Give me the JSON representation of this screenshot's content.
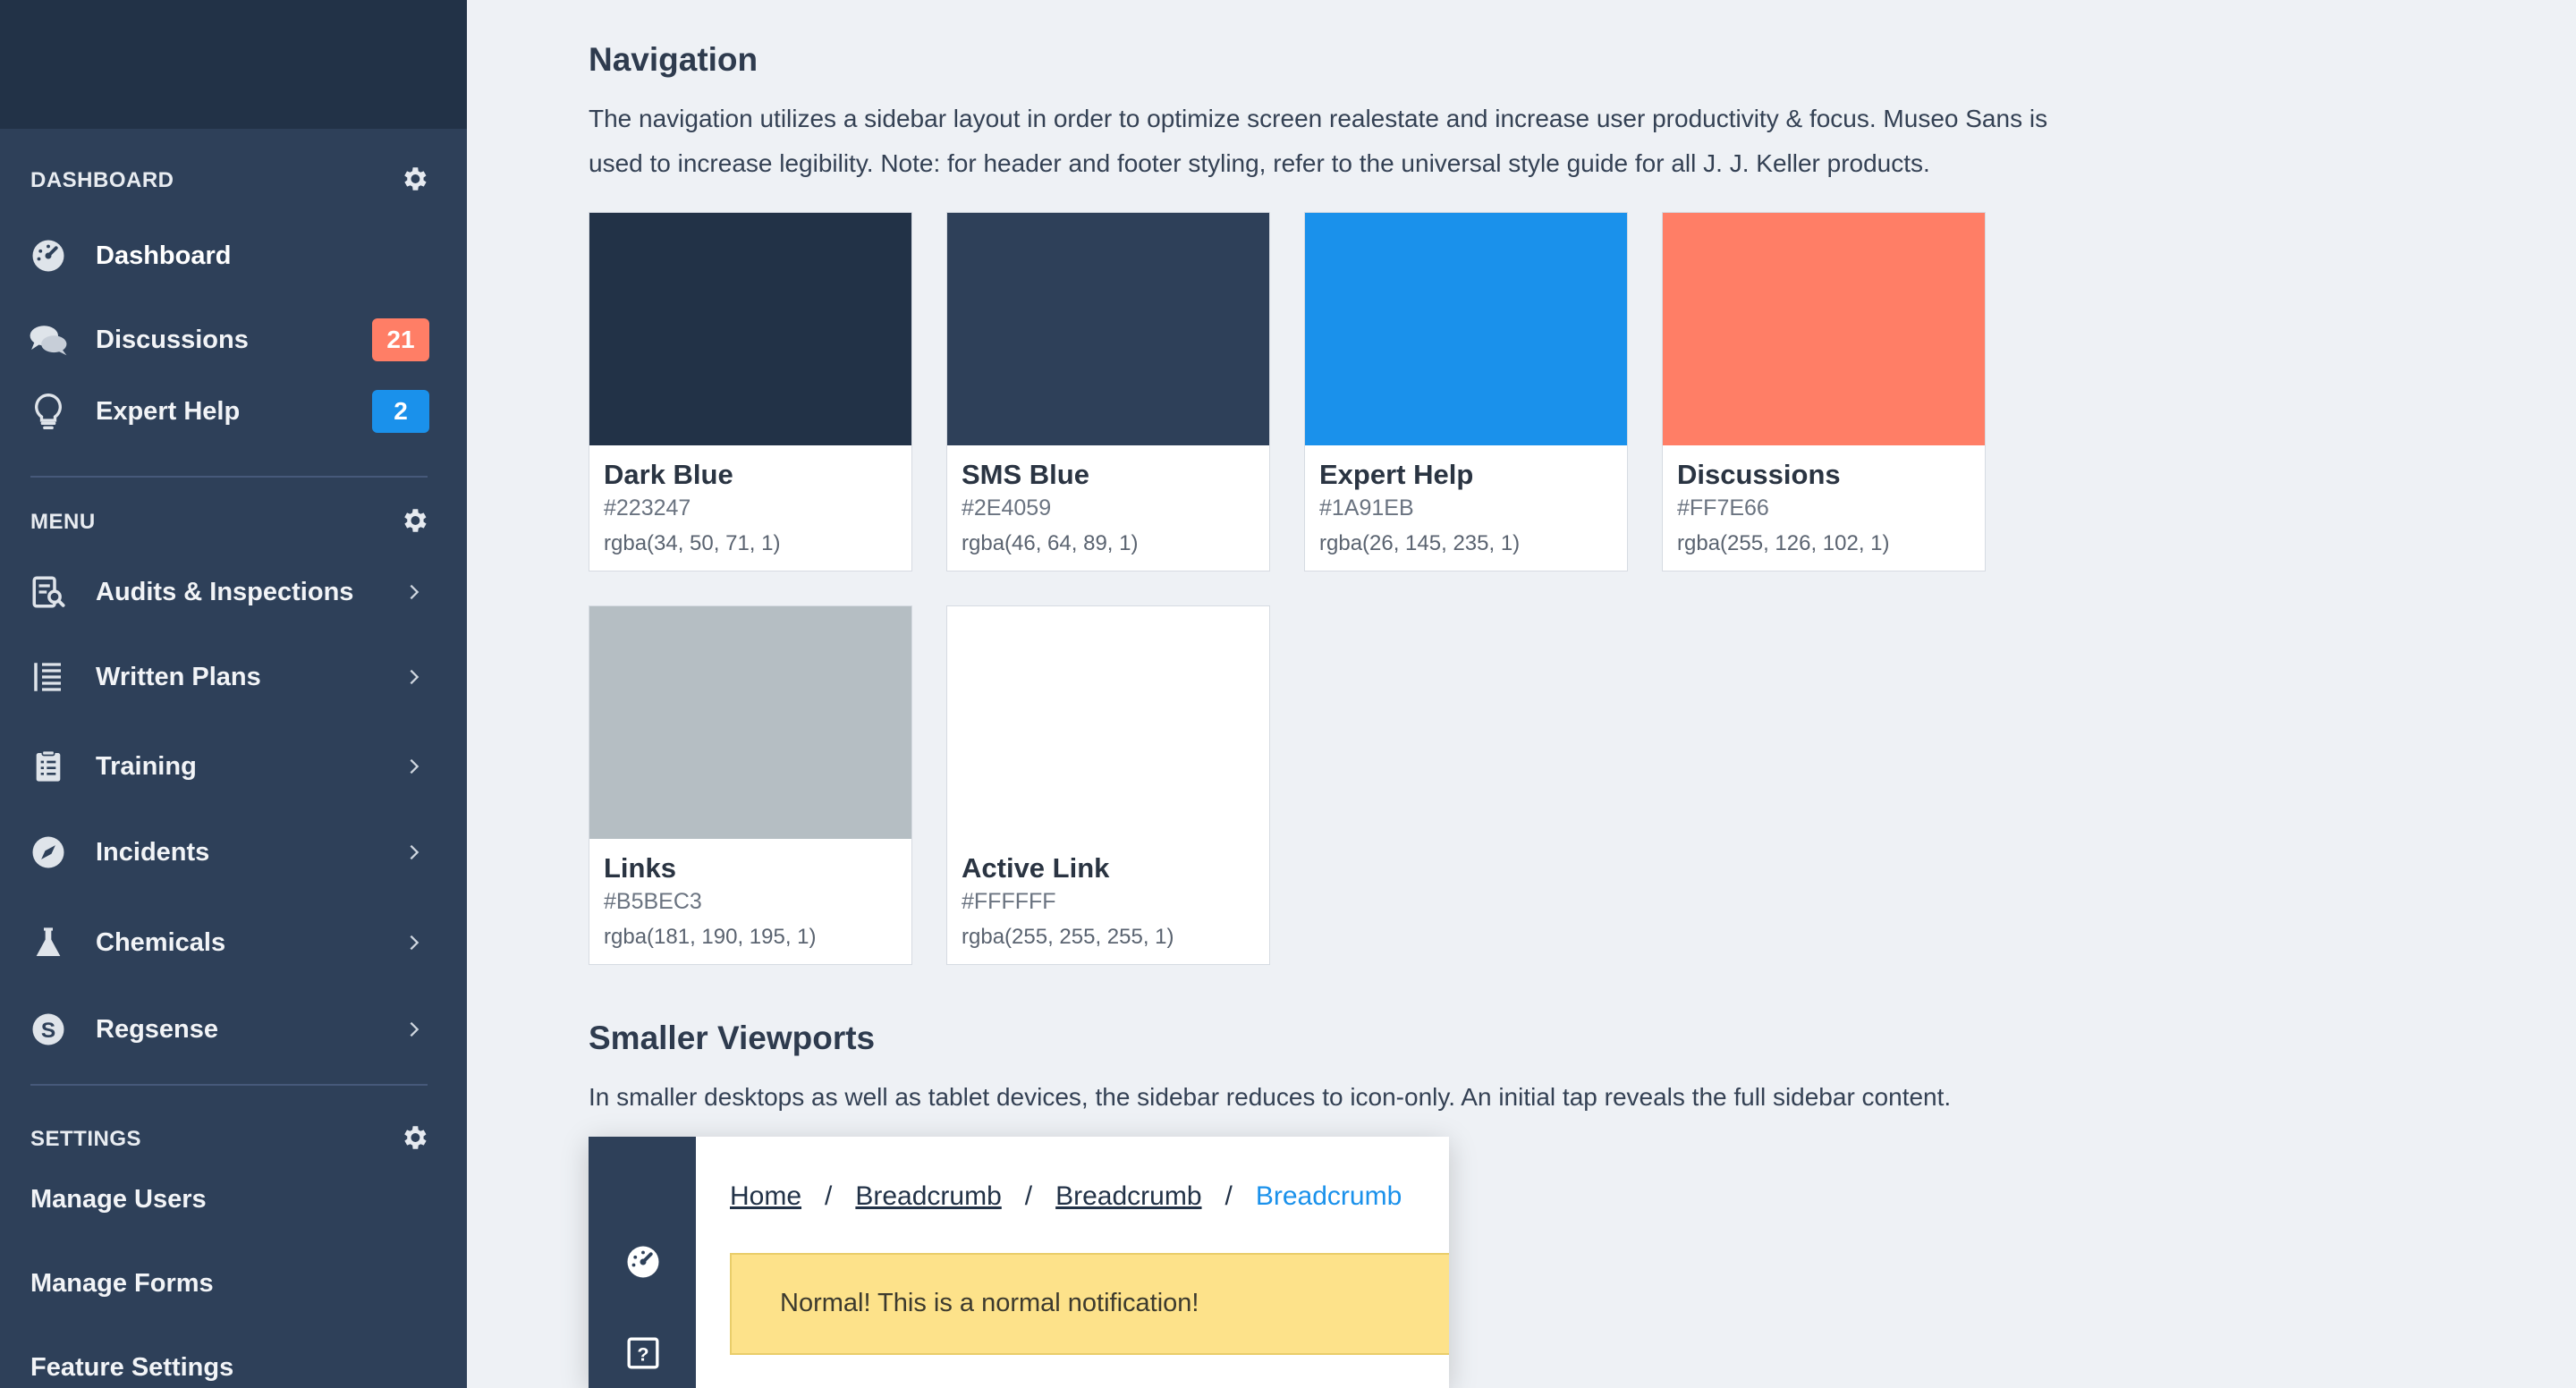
{
  "sidebar": {
    "sections": {
      "dashboard": "DASHBOARD",
      "menu": "MENU",
      "settings": "SETTINGS"
    },
    "primary": [
      {
        "label": "Dashboard",
        "icon": "dashboard-gauge-icon"
      },
      {
        "label": "Discussions",
        "icon": "chat-bubbles-icon",
        "badge": "21",
        "badge_color": "#FF7E66"
      },
      {
        "label": "Expert Help",
        "icon": "lightbulb-icon",
        "badge": "2",
        "badge_color": "#1A91EB"
      }
    ],
    "menu": [
      {
        "label": "Audits & Inspections",
        "icon": "clipboard-search-icon"
      },
      {
        "label": "Written Plans",
        "icon": "notebook-icon"
      },
      {
        "label": "Training",
        "icon": "checklist-icon"
      },
      {
        "label": "Incidents",
        "icon": "compass-icon"
      },
      {
        "label": "Chemicals",
        "icon": "flask-icon"
      },
      {
        "label": "Regsense",
        "icon": "regsense-logo-icon"
      }
    ],
    "settings": [
      {
        "label": "Manage Users"
      },
      {
        "label": "Manage Forms"
      },
      {
        "label": "Feature Settings"
      }
    ]
  },
  "navigation": {
    "title": "Navigation",
    "description": "The navigation utilizes a sidebar layout in order to optimize screen realestate and increase user productivity & focus. Museo Sans is used to increase legibility. Note: for header and footer styling, refer to the universal style guide for all J. J. Keller products."
  },
  "swatches": [
    {
      "name": "Dark Blue",
      "hex": "#223247",
      "rgba": "rgba(34, 50, 71, 1)"
    },
    {
      "name": "SMS Blue",
      "hex": "#2E4059",
      "rgba": "rgba(46, 64, 89, 1)"
    },
    {
      "name": "Expert Help",
      "hex": "#1A91EB",
      "rgba": "rgba(26, 145, 235, 1)"
    },
    {
      "name": "Discussions",
      "hex": "#FF7E66",
      "rgba": "rgba(255, 126, 102, 1)"
    },
    {
      "name": "Links",
      "hex": "#B5BEC3",
      "rgba": "rgba(181, 190, 195, 1)"
    },
    {
      "name": "Active Link",
      "hex": "#FFFFFF",
      "rgba": "rgba(255, 255, 255, 1)"
    }
  ],
  "smaller": {
    "title": "Smaller Viewports",
    "description": "In smaller desktops as well as tablet devices, the sidebar reduces to icon-only. An initial tap reveals the full sidebar content."
  },
  "example": {
    "breadcrumbs": [
      "Home",
      "Breadcrumb",
      "Breadcrumb",
      "Breadcrumb"
    ],
    "separator": "/",
    "notification": "Normal! This is a normal notification!"
  }
}
